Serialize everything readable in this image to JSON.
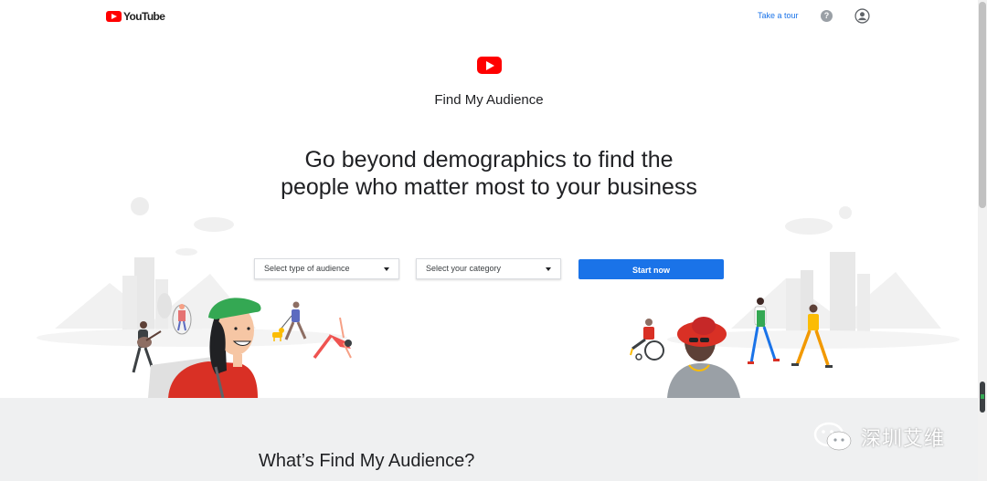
{
  "header": {
    "logo_text": "YouTube",
    "tour_link": "Take a tour",
    "help_icon": "question-circle-icon",
    "account_icon": "account-circle-icon"
  },
  "hero": {
    "product_name": "Find My Audience",
    "headline_line1": "Go beyond demographics to find the",
    "headline_line2": "people who matter most to your business"
  },
  "form": {
    "audience_select": "Select type of audience",
    "category_select": "Select your category",
    "start_button": "Start now"
  },
  "section": {
    "title": "What’s Find My Audience?"
  },
  "watermark": {
    "text": "深圳艾维"
  },
  "colors": {
    "brand_red": "#ff0000",
    "accent_blue": "#1a73e8",
    "section_bg": "#eff0f1"
  }
}
